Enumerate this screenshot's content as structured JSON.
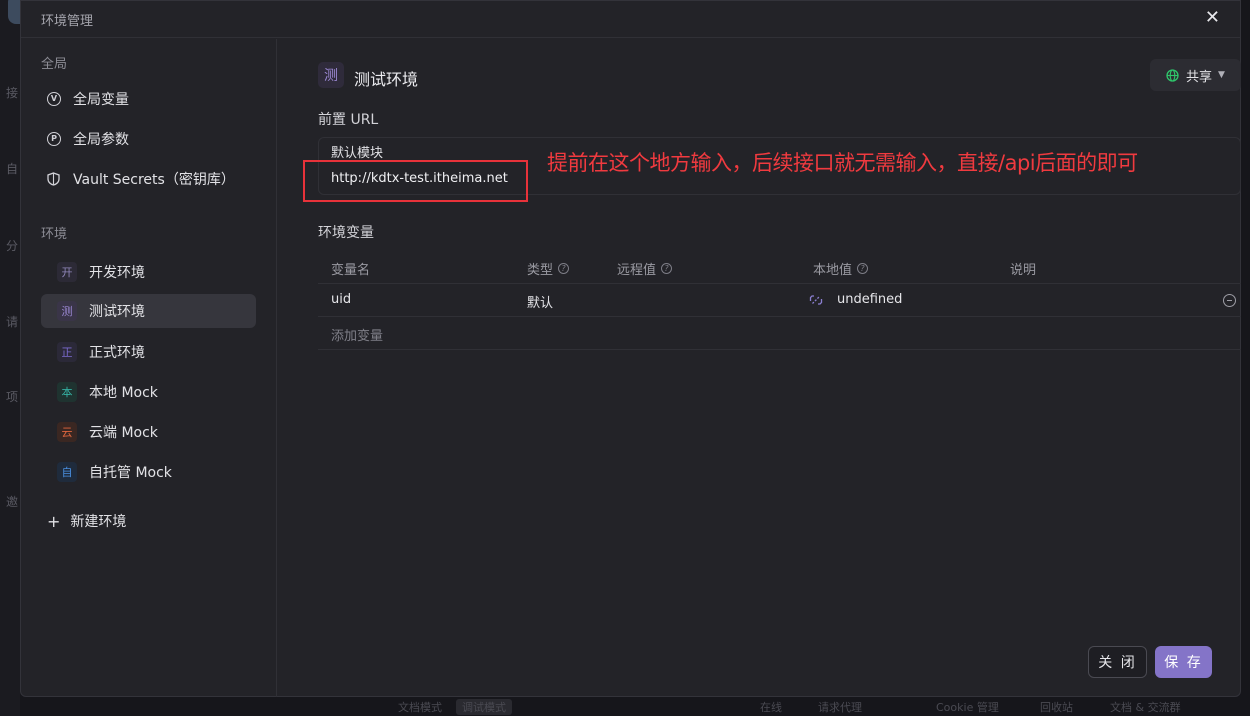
{
  "background": {
    "side_letters": [
      "接",
      "自",
      "分",
      "请",
      "项",
      "邀"
    ],
    "bottom": [
      "文档模式",
      "调试模式",
      "在线",
      "请求代理",
      "Cookie 管理",
      "回收站",
      "文档 & 交流群"
    ]
  },
  "modal": {
    "title": "环境管理",
    "close_icon": "close-icon"
  },
  "sidebar": {
    "global_label": "全局",
    "global_items": [
      {
        "icon": "V",
        "label": "全局变量"
      },
      {
        "icon": "P",
        "label": "全局参数"
      },
      {
        "icon": "shield-icon",
        "label": "Vault Secrets（密钥库）"
      }
    ],
    "env_label": "环境",
    "environments": [
      {
        "badge": "开",
        "label": "开发环境",
        "color": "#8f86b8",
        "bg": "#2c2a36"
      },
      {
        "badge": "测",
        "label": "测试环境",
        "color": "#9d8ad6",
        "bg": "#3a3548",
        "active": true
      },
      {
        "badge": "正",
        "label": "正式环境",
        "color": "#7b6bd0",
        "bg": "#2b2938"
      },
      {
        "badge": "本",
        "label": "本地 Mock",
        "color": "#35b0a2",
        "bg": "#1f3330"
      },
      {
        "badge": "云",
        "label": "云端 Mock",
        "color": "#e0663e",
        "bg": "#3a2722"
      },
      {
        "badge": "自",
        "label": "自托管 Mock",
        "color": "#4a8fe0",
        "bg": "#1f2b3c"
      }
    ],
    "new_env": "新建环境"
  },
  "main": {
    "env_badge": "测",
    "env_name": "测试环境",
    "share_label": "共享",
    "prefix_url_label": "前置 URL",
    "default_module_label": "默认模块",
    "url_value": "http://kdtx-test.itheima.net",
    "env_vars_label": "环境变量",
    "columns": {
      "name": "变量名",
      "type": "类型",
      "remote": "远程值",
      "local": "本地值",
      "desc": "说明"
    },
    "rows": [
      {
        "name": "uid",
        "type": "默认",
        "remote": "",
        "local": "undefined",
        "desc": ""
      }
    ],
    "add_var": "添加变量"
  },
  "annotation": {
    "text": "提前在这个地方输入，后续接口就无需输入，直接/api后面的即可",
    "color": "#f03a3f"
  },
  "footer": {
    "close_label": "关 闭",
    "save_label": "保 存",
    "accent": "#8474c8"
  }
}
